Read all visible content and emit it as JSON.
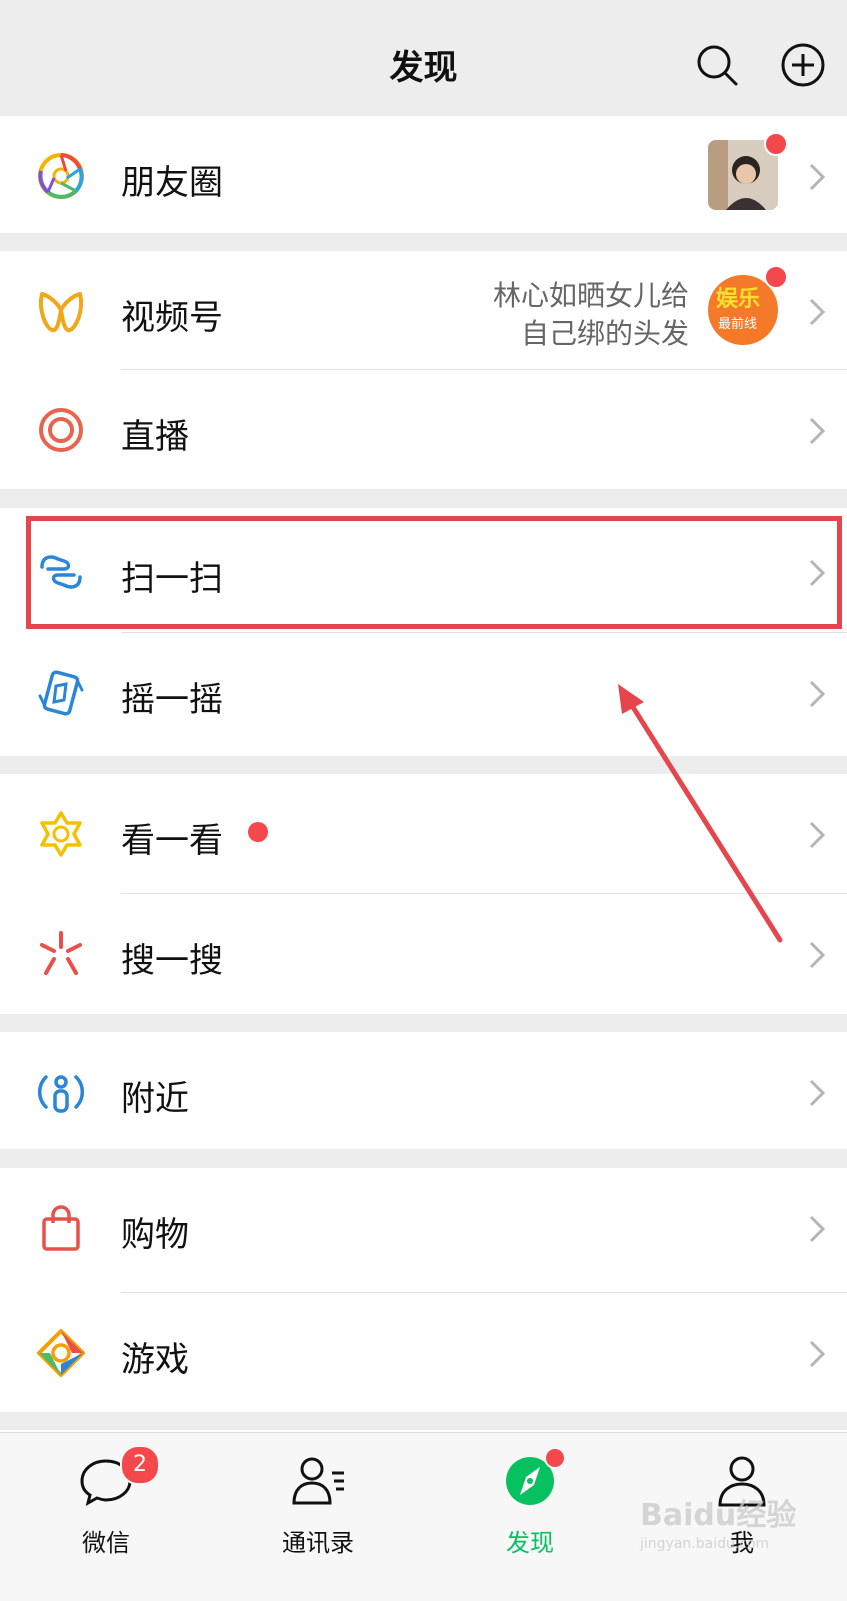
{
  "header": {
    "title": "发现",
    "search_icon": "search-icon",
    "add_icon": "plus-circle-icon"
  },
  "menu": {
    "moments": {
      "label": "朋友圈",
      "icon": "moments-aperture-icon"
    },
    "channels": {
      "label": "视频号",
      "icon": "channels-butterfly-icon",
      "desc_line1": "林心如晒女儿给",
      "desc_line2": "自己绑的头发",
      "thumb_text1": "娱乐",
      "thumb_text2": "最前线"
    },
    "live": {
      "label": "直播",
      "icon": "live-target-icon"
    },
    "scan": {
      "label": "扫一扫",
      "icon": "scan-icon"
    },
    "shake": {
      "label": "摇一摇",
      "icon": "shake-icon"
    },
    "top_stories": {
      "label": "看一看",
      "icon": "top-stories-star-icon"
    },
    "search": {
      "label": "搜一搜",
      "icon": "search-spark-icon"
    },
    "nearby": {
      "label": "附近",
      "icon": "nearby-person-icon"
    },
    "shopping": {
      "label": "购物",
      "icon": "shopping-bag-icon"
    },
    "games": {
      "label": "游戏",
      "icon": "games-diamond-icon"
    }
  },
  "tabbar": {
    "chats": {
      "label": "微信",
      "badge": "2",
      "icon": "chat-bubble-icon"
    },
    "contacts": {
      "label": "通讯录",
      "icon": "contacts-icon"
    },
    "discover": {
      "label": "发现",
      "icon": "compass-icon"
    },
    "me": {
      "label": "我",
      "icon": "person-icon"
    }
  },
  "watermark": {
    "main": "Baidu经验",
    "sub": "jingyan.baidu.com"
  },
  "colors": {
    "accent_green": "#07c160",
    "red_dot": "#f4484d",
    "highlight_red": "#e5454d",
    "background": "#ededed"
  }
}
